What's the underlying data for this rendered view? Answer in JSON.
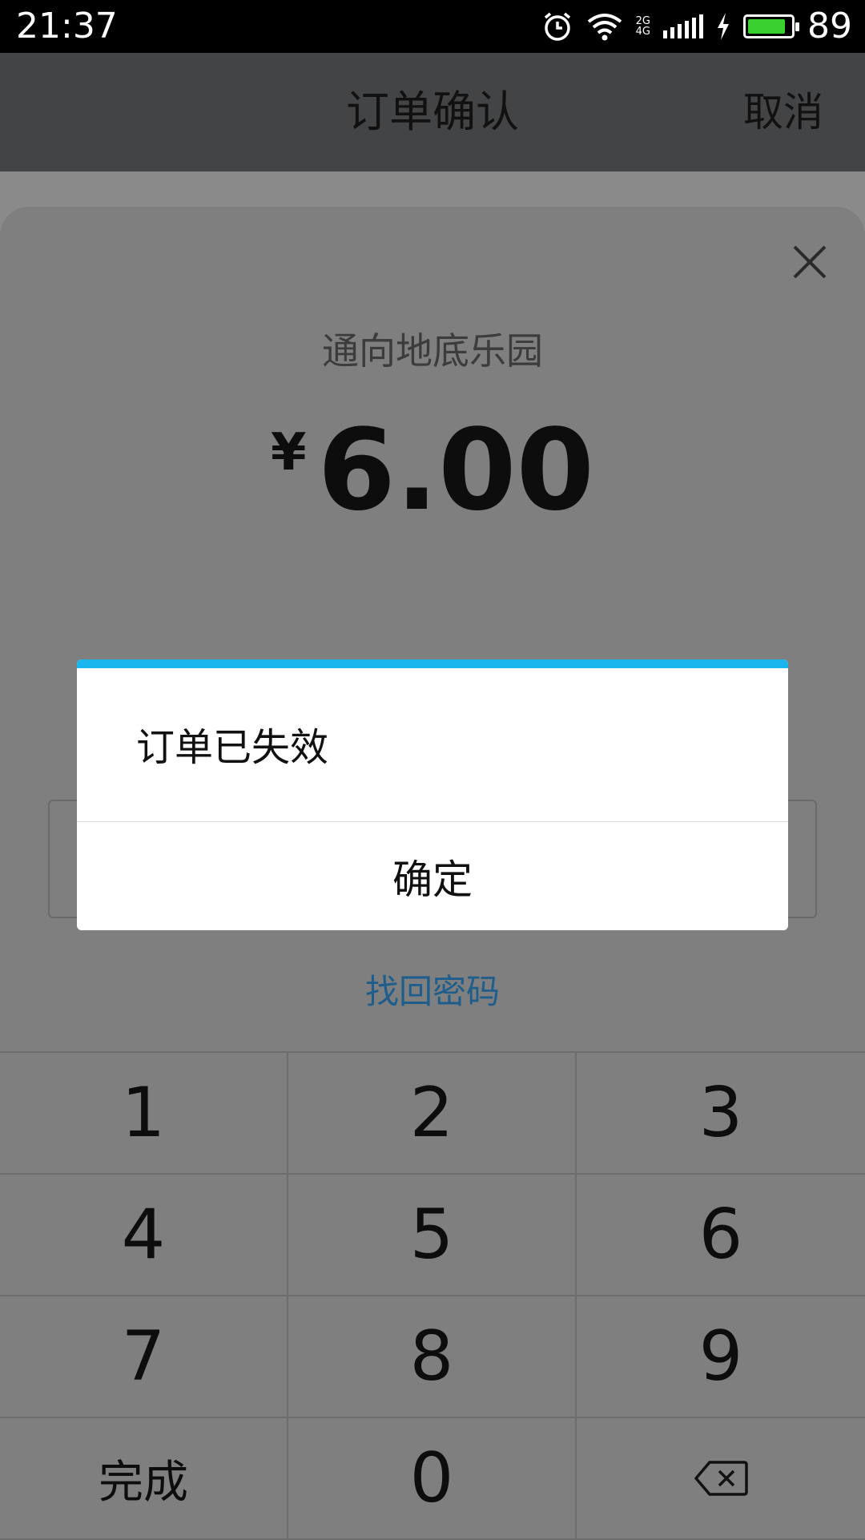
{
  "status_bar": {
    "time": "21:37",
    "network_2g": "2G",
    "network_4g": "4G",
    "battery_percent": "89",
    "battery_level": 0.89,
    "icons": [
      "alarm-icon",
      "wifi-icon",
      "signal-icon",
      "charging-icon",
      "battery-icon"
    ]
  },
  "header": {
    "title": "订单确认",
    "cancel_label": "取消"
  },
  "pay_sheet": {
    "merchant": "通向地底乐园",
    "currency_symbol": "¥",
    "amount": "6.00",
    "forgot_password": "找回密码"
  },
  "keypad": {
    "keys": [
      "1",
      "2",
      "3",
      "4",
      "5",
      "6",
      "7",
      "8",
      "9",
      "完成",
      "0"
    ],
    "backspace_icon": "backspace-icon"
  },
  "dialog": {
    "message": "订单已失效",
    "ok_label": "确定",
    "accent_color": "#1ab5ec"
  }
}
